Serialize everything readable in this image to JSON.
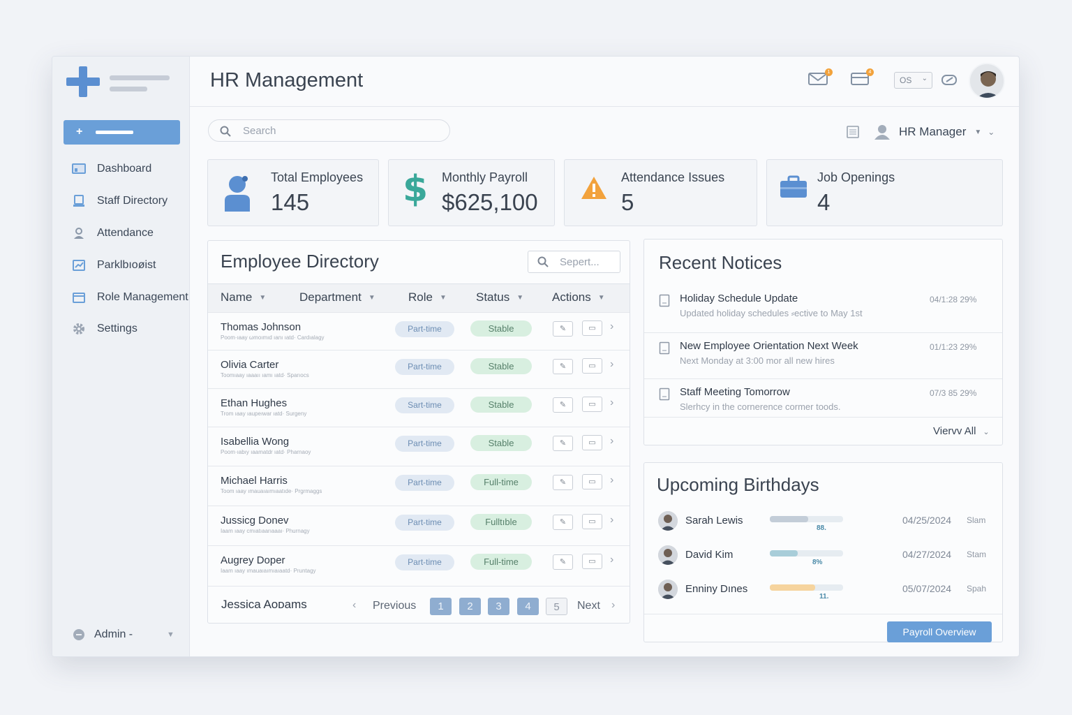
{
  "app": {
    "title": "HR Management"
  },
  "sidebar": {
    "items": [
      {
        "label": "Dashboard",
        "icon": "dashboard-icon"
      },
      {
        "label": "Staff Directory",
        "icon": "monitor-icon"
      },
      {
        "label": "Attendance",
        "icon": "user-icon"
      },
      {
        "label": "Parklbıoøist",
        "icon": "chart-icon"
      },
      {
        "label": "Role Management",
        "icon": "folder-icon"
      },
      {
        "label": "Settings",
        "icon": "gear-icon"
      }
    ],
    "admin_label": "Admin ‑"
  },
  "header": {
    "mail_badge": "1",
    "card_badge": "4",
    "language": "OS",
    "user_label": "HR Manager"
  },
  "search": {
    "placeholder": "Search"
  },
  "stats": [
    {
      "title": "Total Employees",
      "value": "145",
      "icon": "person-icon",
      "color": "#5b8fd1"
    },
    {
      "title": "Monthly Payroll",
      "value": "$625,100",
      "icon": "dollar-icon",
      "color": "#3aa89a"
    },
    {
      "title": "Attendance Issues",
      "value": "5",
      "icon": "warning-icon",
      "color": "#f2a23c"
    },
    {
      "title": "Job Openings",
      "value": "4",
      "icon": "briefcase-icon",
      "color": "#5b8fd1"
    }
  ],
  "directory": {
    "title": "Employee Directory",
    "search_placeholder": "Sepert...",
    "columns": [
      "Name",
      "Department",
      "Role",
      "Status",
      "Actions"
    ],
    "rows": [
      {
        "name": "Thomas Johnson",
        "sub": "Poom·ıaay ωmoımıd ıanı ıatd· Cardıalagy",
        "role": "Part-time",
        "status": "Stable"
      },
      {
        "name": "Olivia Carter",
        "sub": "Toomıaay ıaaaıı ıamı ıatd· Sparıocs",
        "role": "Part-time",
        "status": "Stable"
      },
      {
        "name": "Ethan Hughes",
        "sub": "Trom ıaay ıaupeıwar ıatd· Surgeny",
        "role": "Sart-time",
        "status": "Stable"
      },
      {
        "name": "Isabellia Wong",
        "sub": "Poom·ıabıy ıaamatdr ıatd· Pharnaoy",
        "role": "Part-time",
        "status": "Stable"
      },
      {
        "name": "Michael Harris",
        "sub": "Toom ıaay ımauaıaımıaatıde· Prgrmaggs",
        "role": "Part-time",
        "status": "Full-time"
      },
      {
        "name": "Jussicg Donev",
        "sub": "Iaam ıaay cmıatıaarıaaaı· Phurnagy",
        "role": "Part-time",
        "status": "Fulltıble"
      },
      {
        "name": "Augrey Doper",
        "sub": "Iaam ıaay ımauaıaımıaıaatd· Pruntagy",
        "role": "Part-time",
        "status": "Full-time"
      }
    ],
    "footer_name": "Jessica Aoᴅams",
    "prev_label": "Previous",
    "next_label": "Next",
    "pages": [
      "1",
      "2",
      "3",
      "4",
      "5"
    ]
  },
  "notices": {
    "title": "Recent Notices",
    "items": [
      {
        "title": "Holiday Schedule Update",
        "desc": "Updated holiday schedules ⸗ective to May 1st",
        "time": "04/1:28 29%"
      },
      {
        "title": "New Employee Orientation Next Week",
        "desc": "Next Monday at 3:00 mor all new hires",
        "time": "01/1:23 29%"
      },
      {
        "title": "Staff Meeting Tomorrow",
        "desc": "Slerhcy in the cornerence cormer toods.",
        "time": "07/3 85 29%"
      }
    ],
    "view_all": "Viervv All"
  },
  "birthdays": {
    "title": "Upcoming Birthdays",
    "items": [
      {
        "name": "Sarah Lewis",
        "progress_label": "88.",
        "date": "04/25/2024",
        "tag": "Slam",
        "fill": 0.52,
        "color": "#c3cdd8"
      },
      {
        "name": "David Kim",
        "progress_label": "8%",
        "date": "04/27/2024",
        "tag": "Stam",
        "fill": 0.38,
        "color": "#a8cdd9"
      },
      {
        "name": "Enniny Dınes",
        "progress_label": "11.",
        "date": "05/07/2024",
        "tag": "Spah",
        "fill": 0.62,
        "color": "#f6d49e"
      }
    ],
    "button": "Payroll Overview"
  }
}
